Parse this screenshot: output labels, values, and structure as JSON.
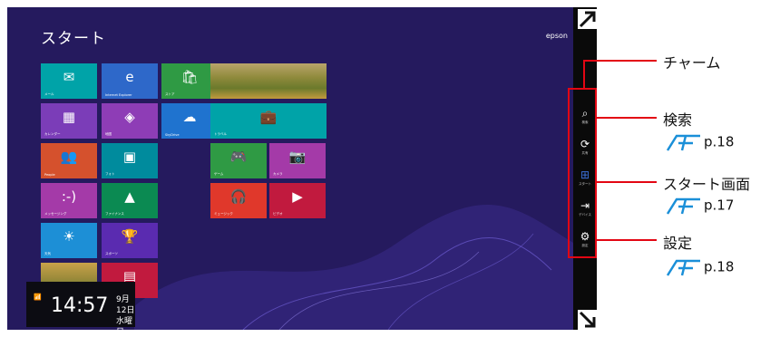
{
  "screen": {
    "title": "スタート",
    "user_name": "epson"
  },
  "tiles": [
    {
      "name": "tile-mail",
      "label": "メール",
      "icon": "✉",
      "color": "#00a3a8"
    },
    {
      "name": "tile-internet-explorer",
      "label": "Internet Explorer",
      "icon": "e",
      "color": "#2e68c9"
    },
    {
      "name": "tile-store",
      "label": "ストア",
      "icon": "🛍",
      "color": "#2f9a44"
    },
    {
      "name": "tile-calendar",
      "label": "カレンダー",
      "icon": "▦",
      "color": "#7b3db8"
    },
    {
      "name": "tile-maps",
      "label": "地図",
      "icon": "◈",
      "color": "#8e3db6"
    },
    {
      "name": "tile-skydrive",
      "label": "SkyDrive",
      "icon": "☁",
      "color": "#1f73cf"
    },
    {
      "name": "tile-people",
      "label": "People",
      "icon": "👥",
      "color": "#d5512d"
    },
    {
      "name": "tile-photos",
      "label": "フォト",
      "icon": "▣",
      "color": "#008b9d"
    },
    {
      "name": "tile-messaging",
      "label": "メッセージング",
      "icon": ":-)",
      "color": "#a43aa8"
    },
    {
      "name": "tile-finance",
      "label": "ファイナンス",
      "icon": "▲",
      "color": "#0b8a52"
    },
    {
      "name": "tile-weather",
      "label": "天気",
      "icon": "☀",
      "color": "#1d8fd6"
    },
    {
      "name": "tile-sports",
      "label": "スポーツ",
      "icon": "🏆",
      "color": "#5a2bb0"
    },
    {
      "name": "tile-desktop",
      "label": "",
      "icon": "",
      "color": "#c8a33c"
    },
    {
      "name": "tile-news",
      "label": "",
      "icon": "▤",
      "color": "#c11a3e"
    },
    {
      "name": "tile-bing",
      "label": "",
      "icon": "",
      "color": "#8a8f3a"
    },
    {
      "name": "tile-travel",
      "label": "トラベル",
      "icon": "💼",
      "color": "#00a3a8"
    },
    {
      "name": "tile-games",
      "label": "ゲーム",
      "icon": "🎮",
      "color": "#2f9a44"
    },
    {
      "name": "tile-camera",
      "label": "カメラ",
      "icon": "📷",
      "color": "#a43aa8"
    },
    {
      "name": "tile-music",
      "label": "ミュージック",
      "icon": "🎧",
      "color": "#e0382b"
    },
    {
      "name": "tile-video",
      "label": "ビデオ",
      "icon": "▶",
      "color": "#c11a3e"
    }
  ],
  "clock": {
    "time": "14:57",
    "date": "9月12日",
    "weekday": "水曜日"
  },
  "charms": [
    {
      "name": "search",
      "label": "検索",
      "icon": "⌕"
    },
    {
      "name": "share",
      "label": "共有",
      "icon": "⟳"
    },
    {
      "name": "start",
      "label": "スタート",
      "icon": "⊞"
    },
    {
      "name": "devices",
      "label": "デバイス",
      "icon": "⇥"
    },
    {
      "name": "settings",
      "label": "設定",
      "icon": "⚙"
    }
  ],
  "annotations": {
    "charm_bar": "チャーム",
    "search": "検索",
    "search_ref": "p.18",
    "start_screen": "スタート画面",
    "start_ref": "p.17",
    "settings": "設定",
    "settings_ref": "p.18"
  },
  "colors": {
    "background": "#251a5e",
    "charm_bar": "#0a0a0a",
    "annotation_accent": "#e30613"
  }
}
